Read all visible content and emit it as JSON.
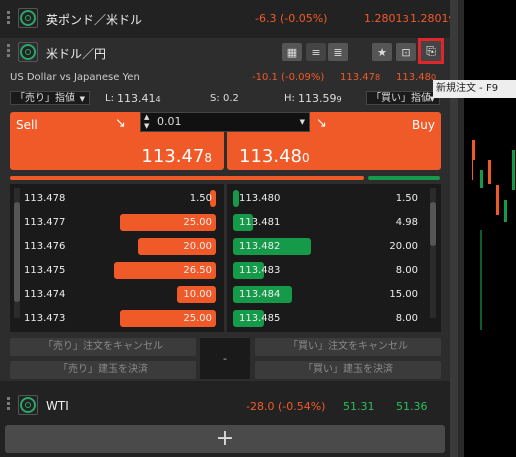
{
  "pairs": {
    "gbpusd": {
      "name": "英ポンド／米ドル",
      "change": "-6.3 (-0.05%)",
      "bid": "1.2801",
      "bid_sub": "3",
      "ask": "1.2801",
      "ask_sub": "9"
    },
    "usdjpy": {
      "name": "米ドル／円",
      "full_name": "US Dollar vs Japanese Yen",
      "change": "-10.1 (-0.09%)",
      "bid": "113.47",
      "bid_sub": "8",
      "ask": "113.48",
      "ask_sub": "0",
      "sell_order_type": "「売り」指値",
      "buy_order_type": "「買い」指値",
      "low_label": "L:",
      "low": "113.41",
      "low_sub": "4",
      "spread_label": "S:",
      "spread": "0.2",
      "high_label": "H:",
      "high": "113.59",
      "high_sub": "9",
      "sell_label": "Sell",
      "buy_label": "Buy",
      "quantity": "0.01",
      "sell_price_main": "113.47",
      "sell_price_sub": "8",
      "buy_price_main": "113.48",
      "buy_price_sub": "0",
      "book_bids": [
        {
          "price": "113.478",
          "qty": "1.50",
          "fill": 0.04
        },
        {
          "price": "113.477",
          "qty": "25.00",
          "fill": 0.72
        },
        {
          "price": "113.476",
          "qty": "20.00",
          "fill": 0.58
        },
        {
          "price": "113.475",
          "qty": "26.50",
          "fill": 0.76
        },
        {
          "price": "113.474",
          "qty": "10.00",
          "fill": 0.29
        },
        {
          "price": "113.473",
          "qty": "25.00",
          "fill": 0.72
        }
      ],
      "book_asks": [
        {
          "price": "113.480",
          "qty": "1.50",
          "fill": 0.04
        },
        {
          "price": "113.481",
          "qty": "4.98",
          "fill": 0.15
        },
        {
          "price": "113.482",
          "qty": "20.00",
          "fill": 0.58
        },
        {
          "price": "113.483",
          "qty": "8.00",
          "fill": 0.23
        },
        {
          "price": "113.484",
          "qty": "15.00",
          "fill": 0.44
        },
        {
          "price": "113.485",
          "qty": "8.00",
          "fill": 0.23
        }
      ],
      "cancel_sell": "「売り」注文をキャンセル",
      "cancel_buy": "「買い」注文をキャンセル",
      "close_sell": "「売り」建玉を決済",
      "close_buy": "「買い」建玉を決済",
      "net_position": "-"
    },
    "wti": {
      "name": "WTI",
      "change": "-28.0 (-0.54%)",
      "bid": "51.31",
      "ask": "51.36"
    }
  },
  "add_button": "+",
  "tooltip": "新規注文 - F9",
  "colors": {
    "sell": "#f05a28",
    "buy": "#159a4a",
    "highlight": "#e0262a"
  }
}
